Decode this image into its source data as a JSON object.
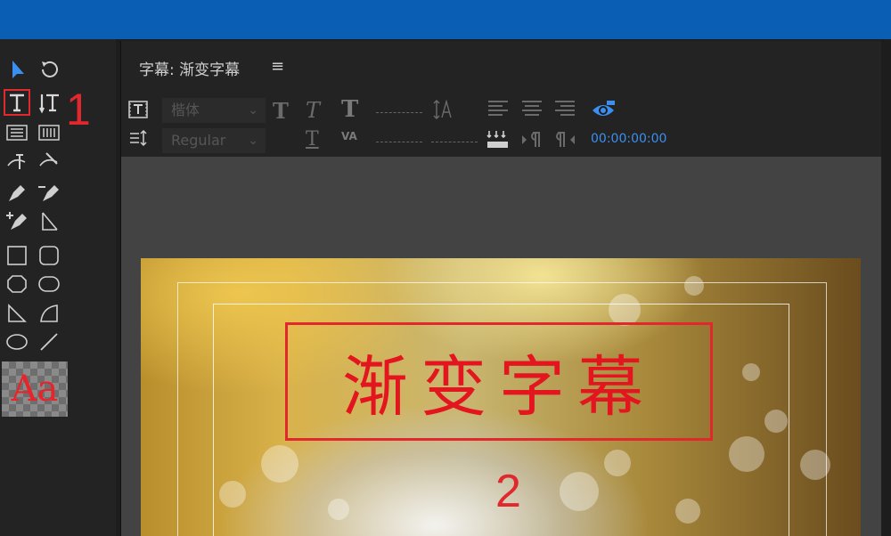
{
  "app": {
    "accent_color": "#0a5fb4",
    "annotation_color": "#e0282d"
  },
  "tools": {
    "items": [
      "selection-tool",
      "rotation-tool",
      "type-tool",
      "vertical-type-tool",
      "area-type-tool",
      "vertical-area-type-tool",
      "path-type-tool",
      "vertical-path-type-tool",
      "pen-tool",
      "delete-anchor-point-tool",
      "add-anchor-point-tool",
      "convert-anchor-point-tool",
      "rectangle-tool",
      "rounded-rectangle-tool",
      "clipped-corner-rectangle-tool",
      "rounded-corner-rectangle-tool",
      "wedge-tool",
      "arc-tool",
      "ellipse-tool",
      "line-tool"
    ],
    "style_swatch": "Aa",
    "annotation_1": "1"
  },
  "panel": {
    "title": "字幕: 渐变字幕",
    "menu_icon": "≡",
    "font_family": "楷体",
    "font_style": "Regular",
    "bold_glyph": "T",
    "italic_glyph": "T",
    "underline_glyph": "T",
    "size_glyph": "T",
    "kerning_glyph": "VA",
    "timecode": "00:00:00:00"
  },
  "canvas": {
    "title_text": "渐变字幕",
    "title_color": "#e3161f",
    "annotation_2": "2"
  }
}
